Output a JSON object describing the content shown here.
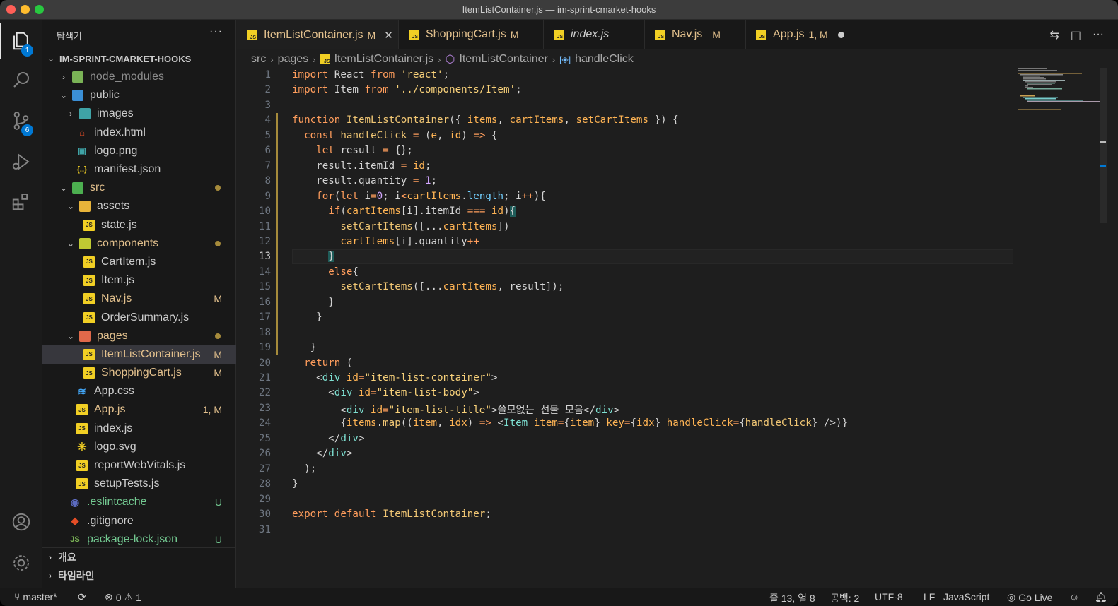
{
  "window": {
    "title": "ItemListContainer.js — im-sprint-cmarket-hooks"
  },
  "activity": {
    "explorer_badge": "1",
    "scm_badge": "6"
  },
  "sidebar": {
    "header": "탐색기",
    "more": "···",
    "project": "IM-SPRINT-CMARKET-HOOKS",
    "items": [
      {
        "name": "node_modules",
        "deco": ""
      },
      {
        "name": "public",
        "deco": ""
      },
      {
        "name": "images",
        "deco": ""
      },
      {
        "name": "index.html",
        "deco": ""
      },
      {
        "name": "logo.png",
        "deco": ""
      },
      {
        "name": "manifest.json",
        "deco": ""
      },
      {
        "name": "src",
        "deco": ""
      },
      {
        "name": "assets",
        "deco": ""
      },
      {
        "name": "state.js",
        "deco": ""
      },
      {
        "name": "components",
        "deco": ""
      },
      {
        "name": "CartItem.js",
        "deco": ""
      },
      {
        "name": "Item.js",
        "deco": ""
      },
      {
        "name": "Nav.js",
        "deco": "M"
      },
      {
        "name": "OrderSummary.js",
        "deco": ""
      },
      {
        "name": "pages",
        "deco": ""
      },
      {
        "name": "ItemListContainer.js",
        "deco": "M"
      },
      {
        "name": "ShoppingCart.js",
        "deco": "M"
      },
      {
        "name": "App.css",
        "deco": ""
      },
      {
        "name": "App.js",
        "deco": "1, M"
      },
      {
        "name": "index.js",
        "deco": ""
      },
      {
        "name": "logo.svg",
        "deco": ""
      },
      {
        "name": "reportWebVitals.js",
        "deco": ""
      },
      {
        "name": "setupTests.js",
        "deco": ""
      },
      {
        "name": ".eslintcache",
        "deco": "U"
      },
      {
        "name": ".gitignore",
        "deco": ""
      },
      {
        "name": "package-lock.json",
        "deco": "U"
      }
    ],
    "outline": "개요",
    "timeline": "타임라인"
  },
  "tabs": [
    {
      "label": "ItemListContainer.js",
      "flag": "M",
      "close": "✕"
    },
    {
      "label": "ShoppingCart.js",
      "flag": "M"
    },
    {
      "label": "index.js",
      "flag": ""
    },
    {
      "label": "Nav.js",
      "flag": "M"
    },
    {
      "label": "App.js",
      "flag": "1, M"
    }
  ],
  "breadcrumb": {
    "parts": [
      "src",
      "pages",
      "ItemListContainer.js",
      "ItemListContainer",
      "handleClick"
    ]
  },
  "editor": {
    "current_line": 13,
    "line_numbers": [
      "1",
      "2",
      "3",
      "4",
      "5",
      "6",
      "7",
      "8",
      "9",
      "10",
      "11",
      "12",
      "13",
      "14",
      "15",
      "16",
      "17",
      "18",
      "19",
      "20",
      "21",
      "22",
      "23",
      "24",
      "25",
      "26",
      "27",
      "28",
      "29",
      "30",
      "31"
    ],
    "lines": [
      [
        [
          "kw",
          "import"
        ],
        [
          "var",
          " React "
        ],
        [
          "kw",
          "from"
        ],
        [
          "var",
          " "
        ],
        [
          "str",
          "'react'"
        ],
        [
          "var",
          ";"
        ]
      ],
      [
        [
          "kw",
          "import"
        ],
        [
          "var",
          " Item "
        ],
        [
          "kw",
          "from"
        ],
        [
          "var",
          " "
        ],
        [
          "str",
          "'../components/Item'"
        ],
        [
          "var",
          ";"
        ]
      ],
      [],
      [
        [
          "kw",
          "function"
        ],
        [
          "var",
          " "
        ],
        [
          "fn",
          "ItemListContainer"
        ],
        [
          "var",
          "({ "
        ],
        [
          "prm",
          "items"
        ],
        [
          "var",
          ", "
        ],
        [
          "prm",
          "cartItems"
        ],
        [
          "var",
          ", "
        ],
        [
          "prm",
          "setCartItems"
        ],
        [
          "var",
          " }) {"
        ]
      ],
      [
        [
          "var",
          "  "
        ],
        [
          "kw",
          "const"
        ],
        [
          "var",
          " "
        ],
        [
          "fn",
          "handleClick"
        ],
        [
          "var",
          " "
        ],
        [
          "op",
          "="
        ],
        [
          "var",
          " ("
        ],
        [
          "prm",
          "e"
        ],
        [
          "var",
          ", "
        ],
        [
          "prm",
          "id"
        ],
        [
          "var",
          ") "
        ],
        [
          "op",
          "=>"
        ],
        [
          "var",
          " {"
        ]
      ],
      [
        [
          "var",
          "    "
        ],
        [
          "kw",
          "let"
        ],
        [
          "var",
          " result "
        ],
        [
          "op",
          "="
        ],
        [
          "var",
          " {};"
        ]
      ],
      [
        [
          "var",
          "    result.itemId "
        ],
        [
          "op",
          "="
        ],
        [
          "var",
          " "
        ],
        [
          "prm",
          "id"
        ],
        [
          "var",
          ";"
        ]
      ],
      [
        [
          "var",
          "    result.quantity "
        ],
        [
          "op",
          "="
        ],
        [
          "var",
          " "
        ],
        [
          "num",
          "1"
        ],
        [
          "var",
          ";"
        ]
      ],
      [
        [
          "var",
          "    "
        ],
        [
          "kw",
          "for"
        ],
        [
          "var",
          "("
        ],
        [
          "kw",
          "let"
        ],
        [
          "var",
          " i"
        ],
        [
          "op",
          "="
        ],
        [
          "num",
          "0"
        ],
        [
          "var",
          "; i"
        ],
        [
          "op",
          "<"
        ],
        [
          "prm",
          "cartItems"
        ],
        [
          "var",
          "."
        ],
        [
          "prop",
          "length"
        ],
        [
          "var",
          "; i"
        ],
        [
          "op",
          "++"
        ],
        [
          "var",
          "){"
        ]
      ],
      [
        [
          "var",
          "      "
        ],
        [
          "kw",
          "if"
        ],
        [
          "var",
          "("
        ],
        [
          "prm",
          "cartItems"
        ],
        [
          "var",
          "[i].itemId "
        ],
        [
          "op",
          "==="
        ],
        [
          "var",
          " "
        ],
        [
          "prm",
          "id"
        ],
        [
          "var",
          ")"
        ],
        [
          "hl",
          "{"
        ]
      ],
      [
        [
          "var",
          "        "
        ],
        [
          "fn",
          "setCartItems"
        ],
        [
          "var",
          "([..."
        ],
        [
          "prm",
          "cartItems"
        ],
        [
          "var",
          "])"
        ]
      ],
      [
        [
          "var",
          "        "
        ],
        [
          "prm",
          "cartItems"
        ],
        [
          "var",
          "[i].quantity"
        ],
        [
          "op",
          "++"
        ]
      ],
      [
        [
          "var",
          "      "
        ],
        [
          "hl",
          "}"
        ]
      ],
      [
        [
          "var",
          "      "
        ],
        [
          "kw",
          "else"
        ],
        [
          "var",
          "{"
        ]
      ],
      [
        [
          "var",
          "        "
        ],
        [
          "fn",
          "setCartItems"
        ],
        [
          "var",
          "([..."
        ],
        [
          "prm",
          "cartItems"
        ],
        [
          "var",
          ", result]);"
        ]
      ],
      [
        [
          "var",
          "      }"
        ]
      ],
      [
        [
          "var",
          "    }"
        ]
      ],
      [],
      [
        [
          "var",
          "   }"
        ]
      ],
      [
        [
          "var",
          "  "
        ],
        [
          "kw",
          "return"
        ],
        [
          "var",
          " ("
        ]
      ],
      [
        [
          "var",
          "    <"
        ],
        [
          "tag",
          "div"
        ],
        [
          "var",
          " "
        ],
        [
          "attr",
          "id"
        ],
        [
          "op",
          "="
        ],
        [
          "str",
          "\"item-list-container\""
        ],
        [
          "var",
          ">"
        ]
      ],
      [
        [
          "var",
          "      <"
        ],
        [
          "tag",
          "div"
        ],
        [
          "var",
          " "
        ],
        [
          "attr",
          "id"
        ],
        [
          "op",
          "="
        ],
        [
          "str",
          "\"item-list-body\""
        ],
        [
          "var",
          ">"
        ]
      ],
      [
        [
          "var",
          "        <"
        ],
        [
          "tag",
          "div"
        ],
        [
          "var",
          " "
        ],
        [
          "attr",
          "id"
        ],
        [
          "op",
          "="
        ],
        [
          "str",
          "\"item-list-title\""
        ],
        [
          "var",
          ">쓸모없는 선물 모음</"
        ],
        [
          "tag",
          "div"
        ],
        [
          "var",
          ">"
        ]
      ],
      [
        [
          "var",
          "        {"
        ],
        [
          "prm",
          "items"
        ],
        [
          "var",
          "."
        ],
        [
          "fn",
          "map"
        ],
        [
          "var",
          "(("
        ],
        [
          "prm",
          "item"
        ],
        [
          "var",
          ", "
        ],
        [
          "prm",
          "idx"
        ],
        [
          "var",
          ") "
        ],
        [
          "op",
          "=>"
        ],
        [
          "var",
          " <"
        ],
        [
          "tag",
          "Item"
        ],
        [
          "var",
          " "
        ],
        [
          "attr",
          "item"
        ],
        [
          "op",
          "="
        ],
        [
          "var",
          "{"
        ],
        [
          "prm",
          "item"
        ],
        [
          "var",
          "} "
        ],
        [
          "attr",
          "key"
        ],
        [
          "op",
          "="
        ],
        [
          "var",
          "{"
        ],
        [
          "prm",
          "idx"
        ],
        [
          "var",
          "} "
        ],
        [
          "attr",
          "handleClick"
        ],
        [
          "op",
          "="
        ],
        [
          "var",
          "{"
        ],
        [
          "fn",
          "handleClick"
        ],
        [
          "var",
          "} />)}"
        ]
      ],
      [
        [
          "var",
          "      </"
        ],
        [
          "tag",
          "div"
        ],
        [
          "var",
          ">"
        ]
      ],
      [
        [
          "var",
          "    </"
        ],
        [
          "tag",
          "div"
        ],
        [
          "var",
          ">"
        ]
      ],
      [
        [
          "var",
          "  );"
        ]
      ],
      [
        [
          "var",
          "}"
        ]
      ],
      [],
      [
        [
          "kw",
          "export"
        ],
        [
          "var",
          " "
        ],
        [
          "kw",
          "default"
        ],
        [
          "var",
          " "
        ],
        [
          "fn",
          "ItemListContainer"
        ],
        [
          "var",
          ";"
        ]
      ],
      []
    ]
  },
  "status": {
    "branch": "master*",
    "errors": "0",
    "warnings": "1",
    "position": "줄 13, 열 8",
    "spaces": "공백: 2",
    "encoding": "UTF-8",
    "eol": "LF",
    "language": "JavaScript",
    "golive": "Go Live"
  },
  "colors": {
    "accent": "#0078d4",
    "modified": "#e2c08d",
    "untracked": "#73c991"
  }
}
